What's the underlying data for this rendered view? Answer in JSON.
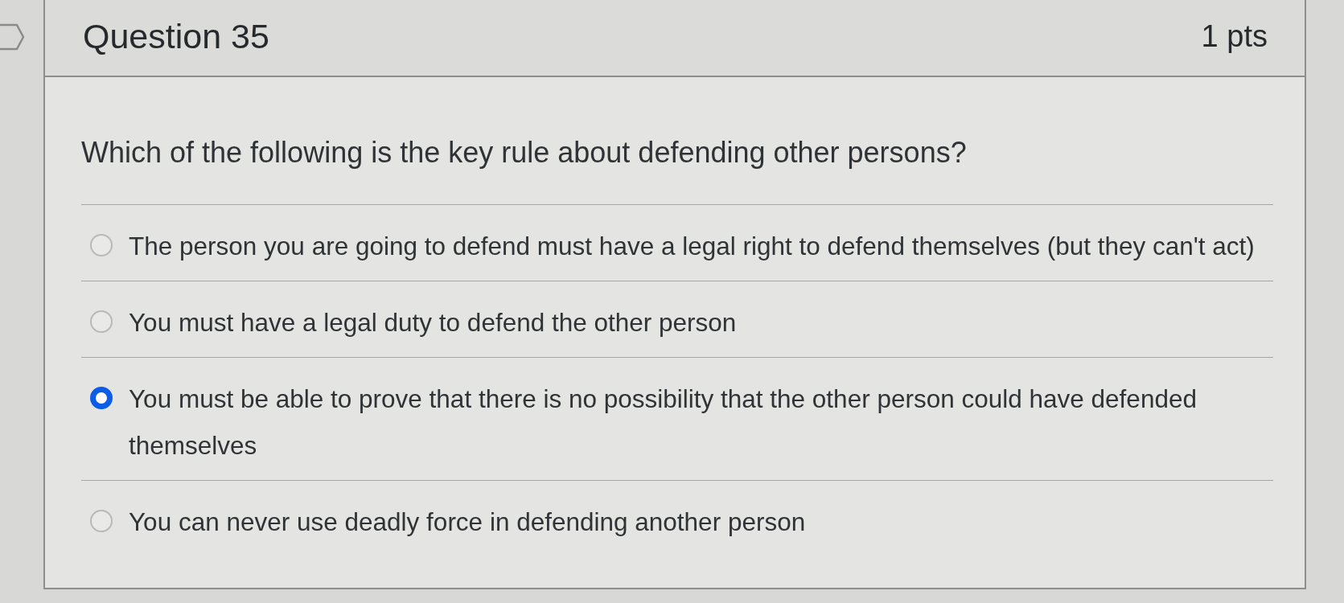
{
  "question": {
    "title": "Question 35",
    "points": "1 pts"
  },
  "prompt": "Which of the following is the key rule about defending other persons?",
  "answers": [
    {
      "text": "The person you are going to defend must have a legal right to defend themselves (but they can't act)",
      "selected": false
    },
    {
      "text": "You must have a legal duty to defend the other person",
      "selected": false
    },
    {
      "text": "You must be able to prove that there is no possibility that the other person could have defended themselves",
      "selected": true
    },
    {
      "text": "You can never use deadly force in defending another person",
      "selected": false
    }
  ]
}
